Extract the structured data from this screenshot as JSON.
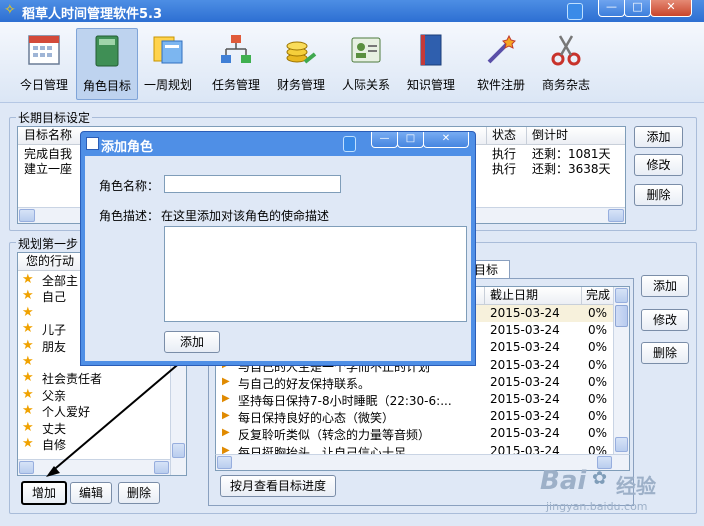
{
  "app": {
    "title": "稻草人时间管理软件5.3",
    "icon": "scarecrow-icon"
  },
  "toolbar": {
    "items": [
      {
        "label": "今日管理",
        "icon": "calendar-icon"
      },
      {
        "label": "角色目标",
        "icon": "book-icon"
      },
      {
        "label": "一周规划",
        "icon": "cards-icon"
      },
      {
        "label": "任务管理",
        "icon": "org-chart-icon"
      },
      {
        "label": "财务管理",
        "icon": "coins-icon"
      },
      {
        "label": "人际关系",
        "icon": "contact-card-icon"
      },
      {
        "label": "知识管理",
        "icon": "bookshelf-icon"
      },
      {
        "label": "软件注册",
        "icon": "magic-wand-icon"
      },
      {
        "label": "商务杂志",
        "icon": "scissors-icon"
      }
    ]
  },
  "long_term": {
    "title": "长期目标设定",
    "columns": [
      "目标名称",
      "状态",
      "倒计时"
    ],
    "rows": [
      {
        "name": "完成自我",
        "status": "执行",
        "countdown": "还剩：1081天"
      },
      {
        "name": "建立一座",
        "status": "执行",
        "countdown": "还剩：3638天"
      }
    ],
    "buttons": {
      "add": "添加",
      "edit": "修改",
      "delete": "删除"
    }
  },
  "plan": {
    "title": "规划第一步",
    "list_header": "您的行动",
    "roles": [
      "全部主",
      "自己",
      "",
      "儿子",
      "朋友",
      "",
      "社会责任者",
      "父亲",
      "个人爱好",
      "丈夫",
      "自修"
    ],
    "buttons": {
      "add": "增加",
      "edit": "编辑",
      "delete": "删除"
    }
  },
  "goals": {
    "tab_label": "目标",
    "columns": [
      "截止日期",
      "完成"
    ],
    "rows": [
      {
        "name": "",
        "date": "2015-03-24",
        "pct": "0%"
      },
      {
        "name": "",
        "date": "2015-03-24",
        "pct": "0%"
      },
      {
        "name": "",
        "date": "2015-03-24",
        "pct": "0%"
      },
      {
        "name": "与自己的人生是一个学而不止的计划",
        "date": "2015-03-24",
        "pct": "0%"
      },
      {
        "name": "与自己的好友保持联系。",
        "date": "2015-03-24",
        "pct": "0%"
      },
      {
        "name": "坚持每日保持7-8小时睡眠（22:30-6:...",
        "date": "2015-03-24",
        "pct": "0%"
      },
      {
        "name": "每日保持良好的心态（微笑）",
        "date": "2015-03-24",
        "pct": "0%"
      },
      {
        "name": "反复聆听类似（转念的力量等音频）",
        "date": "2015-03-24",
        "pct": "0%"
      },
      {
        "name": "每日挺胸抬头，让自己信心十足",
        "date": "2015-03-24",
        "pct": "0%"
      }
    ],
    "buttons": {
      "add": "添加",
      "edit": "修改",
      "delete": "删除",
      "monthly": "按月查看目标进度"
    }
  },
  "dialog": {
    "title": "添加角色",
    "name_label": "角色名称：",
    "name_value": "",
    "desc_label": "角色描述：",
    "desc_hint": "在这里添加对该角色的使命描述",
    "desc_value": "",
    "add_button": "添加"
  },
  "watermark": {
    "brand": "Bai",
    "brand_cn": "经验",
    "url": "jingyan.baidu.com"
  },
  "colors": {
    "title_bar": "#2d6fd2",
    "selected_row": "#f7f1dc",
    "background": "#dfe8f6"
  }
}
